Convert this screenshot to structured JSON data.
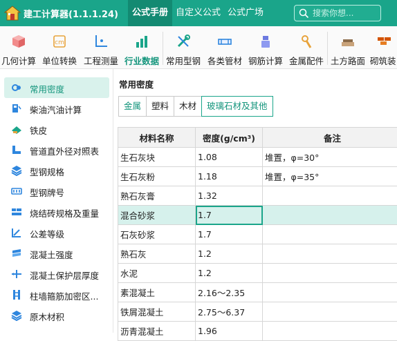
{
  "header": {
    "app_title": "建工计算器(1.1.1.24)",
    "nav_tabs": [
      {
        "label": "公式手册",
        "active": true
      },
      {
        "label": "自定义公式",
        "active": false
      },
      {
        "label": "公式广场",
        "active": false
      }
    ],
    "search_placeholder": "搜索你想..."
  },
  "toolbar": {
    "items": [
      {
        "label": "几何计算",
        "icon": "cube-icon"
      },
      {
        "label": "单位转换",
        "icon": "unit-convert-icon"
      },
      {
        "label": "工程测量",
        "icon": "survey-axis-icon"
      },
      {
        "label": "行业数据",
        "icon": "bar-chart-icon",
        "active": true
      },
      {
        "label": "常用型钢",
        "icon": "wrench-icon"
      },
      {
        "label": "各类管材",
        "icon": "pipe-icon"
      },
      {
        "label": "钢筋计算",
        "icon": "rebar-icon"
      },
      {
        "label": "金属配件",
        "icon": "fitting-icon"
      },
      {
        "label": "土方路面",
        "icon": "earthwork-icon"
      },
      {
        "label": "砌筑装",
        "icon": "masonry-icon"
      }
    ],
    "active_color": "#14957c"
  },
  "sidebar": {
    "items": [
      {
        "label": "常用密度",
        "icon": "density-icon",
        "active": true
      },
      {
        "label": "柴油汽油计算",
        "icon": "fuel-pump-icon"
      },
      {
        "label": "铁皮",
        "icon": "sheet-metal-icon"
      },
      {
        "label": "管道直外径对照表",
        "icon": "pipe-diameter-icon"
      },
      {
        "label": "型钢规格",
        "icon": "stack-icon"
      },
      {
        "label": "型钢牌号",
        "icon": "grade-icon"
      },
      {
        "label": "烧结砖规格及重量",
        "icon": "brick-icon"
      },
      {
        "label": "公差等级",
        "icon": "tolerance-icon"
      },
      {
        "label": "混凝土强度",
        "icon": "concrete-strength-icon"
      },
      {
        "label": "混凝土保护层厚度",
        "icon": "cover-thickness-icon"
      },
      {
        "label": "柱墙箍筋加密区...",
        "icon": "column-stirrup-icon"
      },
      {
        "label": "原木材积",
        "icon": "timber-icon"
      }
    ]
  },
  "main": {
    "section_title": "常用密度",
    "category_tabs": [
      {
        "label": "金属"
      },
      {
        "label": "塑料"
      },
      {
        "label": "木材"
      },
      {
        "label": "玻璃石材及其他",
        "selected": true
      }
    ],
    "table": {
      "columns": [
        "材料名称",
        "密度(g/cm³)",
        "备注"
      ],
      "rows": [
        [
          "生石灰块",
          "1.08",
          "堆置，φ=30°"
        ],
        [
          "生石灰粉",
          "1.18",
          "堆置，φ=35°"
        ],
        [
          "熟石灰膏",
          "1.32",
          ""
        ],
        [
          "混合砂浆",
          "1.7",
          ""
        ],
        [
          "石灰砂浆",
          "1.7",
          ""
        ],
        [
          "熟石灰",
          "1.2",
          ""
        ],
        [
          "水泥",
          "1.2",
          ""
        ],
        [
          "素混凝土",
          "2.16～2.35",
          ""
        ],
        [
          "铁屑混凝土",
          "2.75～6.37",
          ""
        ],
        [
          "沥青混凝土",
          "1.96",
          ""
        ]
      ],
      "highlighted_row": 3
    }
  },
  "colors": {
    "brand": "#1aa58a",
    "brand_dark": "#138a72",
    "highlight_row": "#d6f1ec"
  }
}
